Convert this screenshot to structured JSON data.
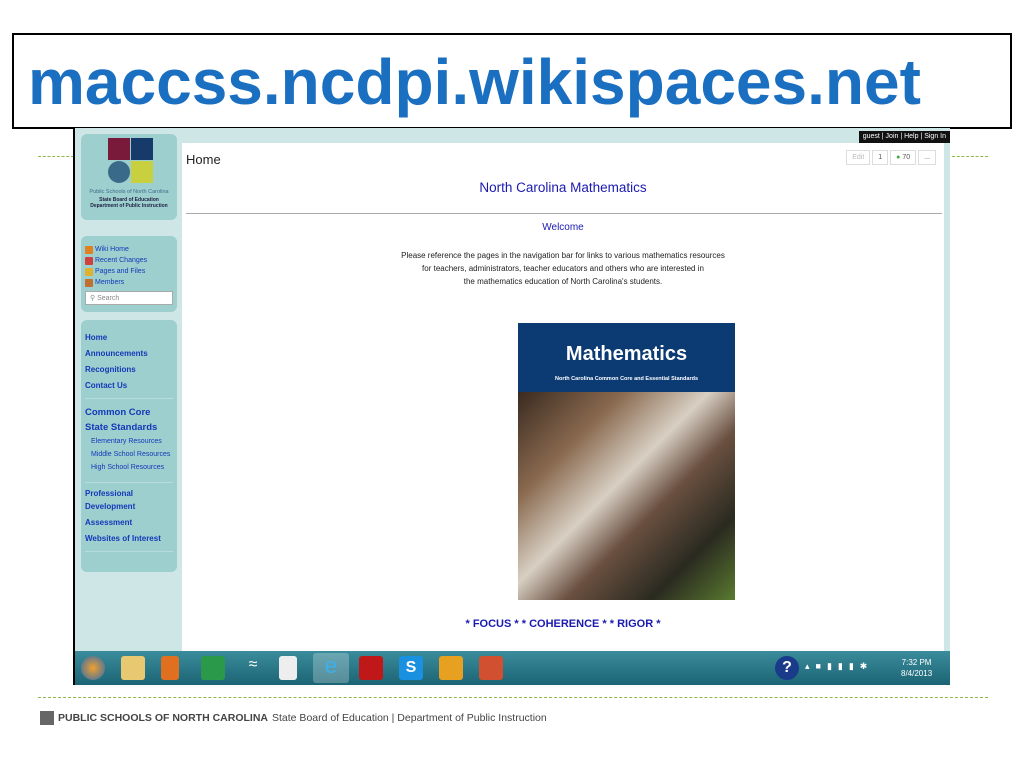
{
  "slide": {
    "title": "maccss.ncdpi.wikispaces.net",
    "footer": {
      "org": "PUBLIC SCHOOLS OF NORTH CAROLINA",
      "rest": "State Board of Education | Department of Public Instruction"
    }
  },
  "wiki": {
    "userbar": "guest | Join | Help | Sign In",
    "logo": {
      "line1": "Public Schools of North Carolina",
      "line2": "State Board of Education",
      "line3": "Department of Public Instruction"
    },
    "tools": [
      {
        "label": "Wiki Home",
        "icon": "home-icon"
      },
      {
        "label": "Recent Changes",
        "icon": "calendar-icon"
      },
      {
        "label": "Pages and Files",
        "icon": "files-icon"
      },
      {
        "label": "Members",
        "icon": "members-icon"
      }
    ],
    "search_placeholder": "Search",
    "nav": {
      "group1": [
        "Home",
        "Announcements",
        "Recognitions",
        "Contact Us"
      ],
      "ccss": "Common Core State Standards",
      "ccss_sub": [
        "Elementary Resources",
        "Middle School Resources",
        "High School Resources"
      ],
      "group3": [
        "Professional Development",
        "Assessment",
        "Websites of Interest"
      ]
    },
    "page_title": "Home",
    "actions": {
      "edit": "Edit",
      "watchers": "1",
      "comments": "70",
      "more": "..."
    },
    "heading": "North Carolina Mathematics",
    "welcome": "Welcome",
    "intro": [
      "Please reference the pages in the navigation bar for links to various mathematics resources",
      "for teachers, administrators, teacher educators and others who are interested in",
      "the mathematics education of North Carolina's students."
    ],
    "cover": {
      "title": "Mathematics",
      "subtitle": "North Carolina Common Core and Essential Standards"
    },
    "tagline": "* FOCUS * * COHERENCE * * RIGOR *"
  },
  "taskbar": {
    "time": "7:32 PM",
    "date": "8/4/2013",
    "apps": [
      "start",
      "file-explorer",
      "media-player",
      "stocks",
      "wifi-app",
      "notepad",
      "internet-explorer",
      "adobe-reader",
      "skype",
      "outlook",
      "powerpoint"
    ]
  }
}
